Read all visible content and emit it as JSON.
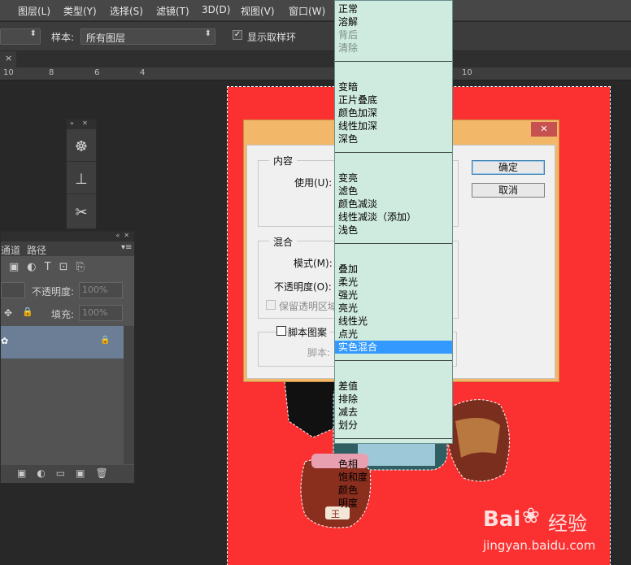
{
  "menubar": {
    "items": [
      "图层(L)",
      "类型(Y)",
      "选择(S)",
      "滤镜(T)",
      "3D(D)",
      "视图(V)",
      "窗口(W)"
    ]
  },
  "options_bar": {
    "sample_label": "样本:",
    "sample_value": "所有图层",
    "show_ring_label": "显示取样环",
    "show_ring_checked": true
  },
  "tab": {
    "close_glyph": "×"
  },
  "ruler": {
    "ticks": [
      "10",
      "8",
      "6",
      "4",
      "10"
    ]
  },
  "layers_panel": {
    "tabs": [
      "通道",
      "路径"
    ],
    "opacity_label": "不透明度:",
    "opacity_value": "100%",
    "fill_label": "填充:",
    "fill_value": "100%"
  },
  "dialog": {
    "content_group": "内容",
    "use_label": "使用(U):",
    "blend_group": "混合",
    "mode_label": "模式(M):",
    "opacity_label": "不透明度(O):",
    "preserve_label": "保留透明区域",
    "script_label": "脚本图案",
    "script_sub": "脚本:",
    "ok": "确定",
    "cancel": "取消",
    "close_glyph": "✕"
  },
  "blend_dropdown": {
    "groups": [
      [
        {
          "label": "正常"
        },
        {
          "label": "溶解"
        },
        {
          "label": "背后",
          "disabled": true
        },
        {
          "label": "清除",
          "disabled": true
        }
      ],
      [
        {
          "label": "变暗"
        },
        {
          "label": "正片叠底"
        },
        {
          "label": "颜色加深"
        },
        {
          "label": "线性加深"
        },
        {
          "label": "深色"
        }
      ],
      [
        {
          "label": "变亮"
        },
        {
          "label": "滤色"
        },
        {
          "label": "颜色减淡"
        },
        {
          "label": "线性减淡（添加）"
        },
        {
          "label": "浅色"
        }
      ],
      [
        {
          "label": "叠加"
        },
        {
          "label": "柔光"
        },
        {
          "label": "强光"
        },
        {
          "label": "亮光"
        },
        {
          "label": "线性光"
        },
        {
          "label": "点光"
        },
        {
          "label": "实色混合",
          "selected": true
        }
      ],
      [
        {
          "label": "差值"
        },
        {
          "label": "排除"
        },
        {
          "label": "减去"
        },
        {
          "label": "划分"
        }
      ],
      [
        {
          "label": "色相"
        },
        {
          "label": "饱和度"
        },
        {
          "label": "颜色"
        },
        {
          "label": "明度"
        }
      ]
    ]
  },
  "watermark": {
    "brand": "Bai",
    "brand2": "经验",
    "url": "jingyan.baidu.com"
  },
  "colors": {
    "canvas": "#fb3030",
    "dropdown_bg": "#cfeadf",
    "selected": "#3399ff",
    "dialog_frame": "#f3b76a"
  }
}
